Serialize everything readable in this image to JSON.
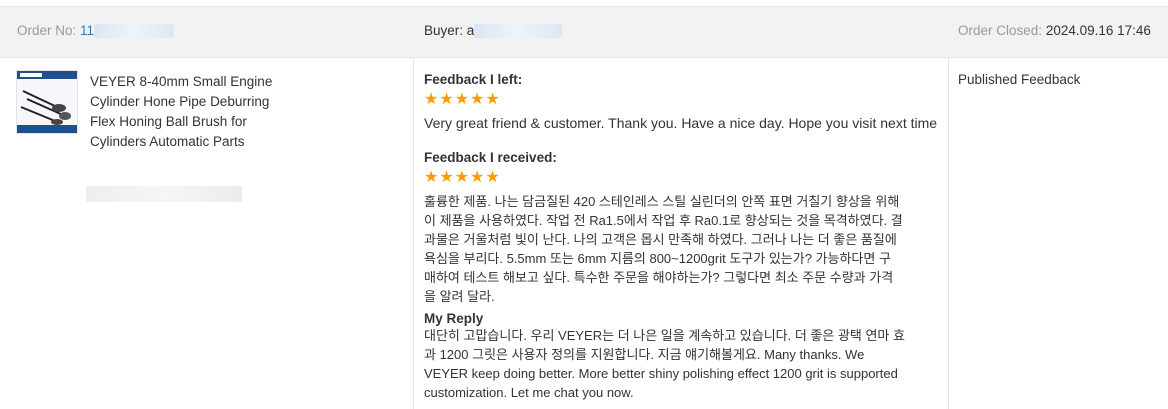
{
  "order": {
    "order_no_label": "Order No:",
    "order_no_value": "11",
    "buyer_label": "Buyer:",
    "buyer_value": "a",
    "closed_label": "Order Closed:",
    "closed_value": "2024.09.16 17:46"
  },
  "product": {
    "title": "VEYER 8-40mm Small Engine Cylinder Hone Pipe Deburring Flex Honing Ball Brush for Cylinders Automatic Parts"
  },
  "feedback": {
    "left_label": "Feedback I left:",
    "left_stars": "★★★★★",
    "left_text": "Very great friend & customer. Thank you. Have a nice day. Hope you visit next time",
    "received_label": "Feedback I received:",
    "received_stars": "★★★★★",
    "received_lines": [
      "훌륭한 제품. 나는 담금질된 420 스테인레스 스틸 실린더의 안쪽 표면 거칠기 향상을 위해",
      "이 제품을 사용하였다. 작업 전 Ra1.5에서 작업 후 Ra0.1로 향상되는 것을 목격하였다. 결",
      "과물은 거울처럼 빛이 난다. 나의 고객은 몹시 만족해 하였다. 그러나 나는 더 좋은 품질에",
      "욕심을 부리다. 5.5mm 또는 6mm 지름의 800~1200grit 도구가 있는가? 가능하다면 구",
      "매하여 테스트 해보고 싶다. 특수한 주문을 해야하는가? 그렇다면 최소 주문 수량과 가격",
      "을 알려 달라."
    ],
    "reply_label": "My Reply",
    "reply_lines": [
      "대단히 고맙습니다. 우리 VEYER는 더 나은 일을 계속하고 있습니다. 더 좋은 광택 연마 효",
      "과 1200 그릿은 사용자 정의를 지원합니다. 지금 얘기해볼게요. Many thanks. We",
      "VEYER keep doing better. More better shiny polishing effect 1200 grit is supported",
      "customization. Let me chat you now."
    ]
  },
  "status": {
    "text": "Published Feedback"
  },
  "colors": {
    "header_bg": "#f2f2f2",
    "star": "#ff9a00",
    "link": "#2a7ab8"
  }
}
